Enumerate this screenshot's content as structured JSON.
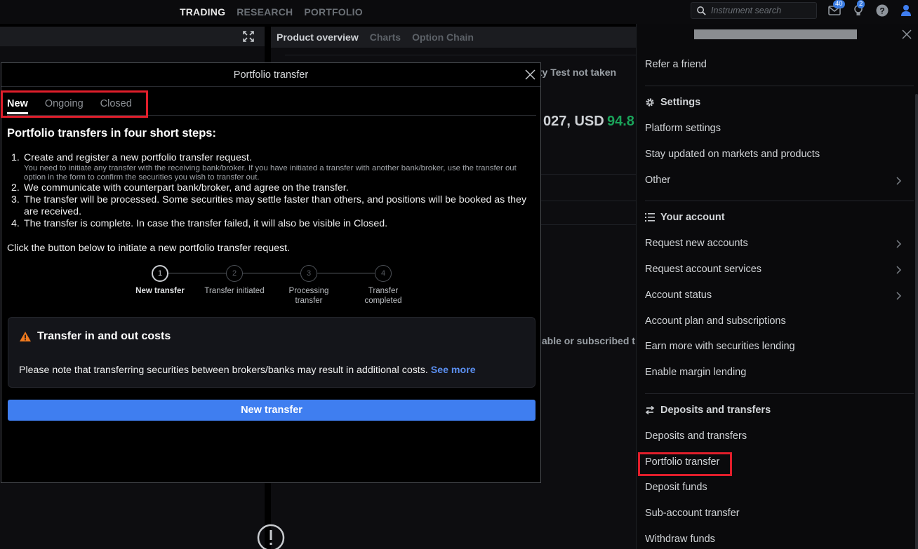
{
  "topbar": {
    "nav": [
      {
        "label": "TRADING",
        "active": true
      },
      {
        "label": "RESEARCH",
        "active": false
      },
      {
        "label": "PORTFOLIO",
        "active": false
      }
    ],
    "search_placeholder": "Instrument search",
    "messages_badge": "40",
    "notifications_badge": "2",
    "icons": [
      "mail-icon",
      "bulb-icon",
      "help-icon",
      "user-icon"
    ]
  },
  "middle": {
    "tabs": [
      {
        "label": "Product overview",
        "active": true
      },
      {
        "label": "Charts",
        "active": false
      },
      {
        "label": "Option Chain",
        "active": false
      }
    ],
    "fragment_1": "ity Test not taken",
    "fragment_2": "027, USD",
    "fragment_3": "94.8",
    "fragment_4": "lable or subscribed t"
  },
  "modal": {
    "title": "Portfolio transfer",
    "tabs": [
      {
        "label": "New",
        "active": true
      },
      {
        "label": "Ongoing",
        "active": false
      },
      {
        "label": "Closed",
        "active": false
      }
    ],
    "heading": "Portfolio transfers in four short steps:",
    "steps": [
      {
        "num": "1.",
        "text": "Create and register a new portfolio transfer request.",
        "sub": "You need to initiate any transfer with the receiving bank/broker. If you have initiated a transfer with another bank/broker, use the transfer out option in the form to confirm the securities you wish to transfer out."
      },
      {
        "num": "2.",
        "text": "We communicate with counterpart bank/broker, and agree on the transfer."
      },
      {
        "num": "3.",
        "text": "The transfer will be processed. Some securities may settle faster than others, and positions will be booked as they are received."
      },
      {
        "num": "4.",
        "text": "The transfer is complete. In case the transfer failed, it will also be visible in Closed."
      }
    ],
    "intro": "Click the button below to initiate a new portfolio transfer request.",
    "stepper": [
      {
        "num": "1",
        "label": "New transfer",
        "active": true
      },
      {
        "num": "2",
        "label": "Transfer initiated",
        "active": false
      },
      {
        "num": "3",
        "label": "Processing transfer",
        "active": false
      },
      {
        "num": "4",
        "label": "Transfer completed",
        "active": false
      }
    ],
    "cost_title": "Transfer in and out costs",
    "cost_text": "Please note that transferring securities between brokers/banks may result in additional costs.",
    "cost_link": "See more",
    "button_label": "New transfer"
  },
  "rightmenu": {
    "refer": "Refer a friend",
    "settings_head": "Settings",
    "platform_settings": "Platform settings",
    "stay_updated": "Stay updated on markets and products",
    "other": "Other",
    "account_head": "Your account",
    "request_accounts": "Request new accounts",
    "request_services": "Request account services",
    "account_status": "Account status",
    "account_plan": "Account plan and subscriptions",
    "earn_more": "Earn more with securities lending",
    "margin": "Enable margin lending",
    "deposits_head": "Deposits and transfers",
    "deposits_transfers": "Deposits and transfers",
    "portfolio_transfer": "Portfolio transfer",
    "deposit_funds": "Deposit funds",
    "subaccount": "Sub-account transfer",
    "withdraw": "Withdraw funds"
  },
  "colors": {
    "accent": "#3f7ef0",
    "link": "#5b8ff0",
    "highlight": "#e01e2b",
    "warning": "#f07a1e",
    "positive": "#1aa35a"
  }
}
